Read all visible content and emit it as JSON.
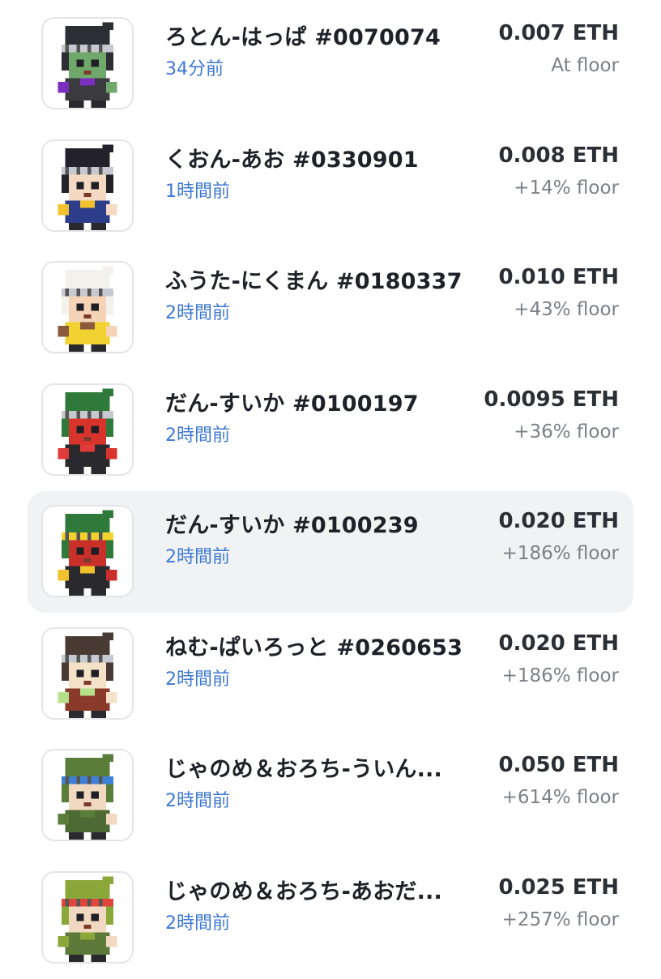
{
  "activity": {
    "items": [
      {
        "name": "ろとん-はっぱ #0070074",
        "time": "34分前",
        "price": "0.007 ETH",
        "floor": "At floor",
        "highlighted": false,
        "avatar": {
          "skin": "#6fa86a",
          "hat": "#2d2d34",
          "band": "#c7c9d0",
          "accent": "#7b2fbe",
          "cloth": "#3a3a3f"
        }
      },
      {
        "name": "くおん-あお #0330901",
        "time": "1時間前",
        "price": "0.008 ETH",
        "floor": "+14% floor",
        "highlighted": false,
        "avatar": {
          "skin": "#f4d9c3",
          "hat": "#222228",
          "band": "#c7c9d0",
          "accent": "#f2c12e",
          "cloth": "#2c3e8a"
        }
      },
      {
        "name": "ふうた-にくまん #0180337",
        "time": "2時間前",
        "price": "0.010 ETH",
        "floor": "+43% floor",
        "highlighted": false,
        "avatar": {
          "skin": "#f4d3b6",
          "hat": "#f4f1ec",
          "band": "#c7c9d0",
          "accent": "#8b5a3c",
          "cloth": "#f2d230"
        }
      },
      {
        "name": "だん-すいか #0100197",
        "time": "2時間前",
        "price": "0.0095 ETH",
        "floor": "+36% floor",
        "highlighted": false,
        "avatar": {
          "skin": "#d9342b",
          "hat": "#2f7a3a",
          "band": "#c7c9d0",
          "accent": "#e03a3a",
          "cloth": "#2a2a2e"
        }
      },
      {
        "name": "だん-すいか #0100239",
        "time": "2時間前",
        "price": "0.020 ETH",
        "floor": "+186% floor",
        "highlighted": true,
        "avatar": {
          "skin": "#c9302a",
          "hat": "#2f7a3a",
          "band": "#f2d230",
          "accent": "#f2c12e",
          "cloth": "#2a2a2e"
        }
      },
      {
        "name": "ねむ-ぱいろっと #0260653",
        "time": "2時間前",
        "price": "0.020 ETH",
        "floor": "+186% floor",
        "highlighted": false,
        "avatar": {
          "skin": "#f4e2c8",
          "hat": "#4a3a34",
          "band": "#c7c9d0",
          "accent": "#b5e08a",
          "cloth": "#8a3a2a"
        }
      },
      {
        "name": "じゃのめ＆おろち-ういん...",
        "time": "2時間前",
        "price": "0.050 ETH",
        "floor": "+614% floor",
        "highlighted": false,
        "avatar": {
          "skin": "#f1d8c0",
          "hat": "#5a7d3a",
          "band": "#3e7fd8",
          "accent": "#5a7d3a",
          "cloth": "#4e6a34"
        }
      },
      {
        "name": "じゃのめ＆おろち-あおだ...",
        "time": "2時間前",
        "price": "0.025 ETH",
        "floor": "+257% floor",
        "highlighted": false,
        "avatar": {
          "skin": "#f1d8c0",
          "hat": "#8aa83a",
          "band": "#e0443a",
          "accent": "#8aa83a",
          "cloth": "#5e7a3a"
        }
      }
    ]
  }
}
